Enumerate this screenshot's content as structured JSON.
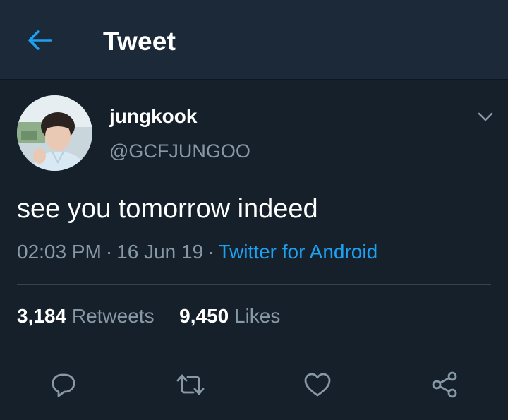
{
  "header": {
    "back_icon": "arrow-left-icon",
    "title": "Tweet"
  },
  "tweet": {
    "display_name": "jungkook",
    "handle": "@GCFJUNGOO",
    "text": "see you tomorrow indeed",
    "time": "02:03 PM",
    "date": "16 Jun 19",
    "separator": "·",
    "source": "Twitter for Android",
    "stats": {
      "retweets_count": "3,184",
      "retweets_label": "Retweets",
      "likes_count": "9,450",
      "likes_label": "Likes"
    }
  },
  "actions": [
    "reply-icon",
    "retweet-icon",
    "like-icon",
    "share-icon"
  ],
  "colors": {
    "background": "#15202b",
    "header": "#1c2938",
    "accent": "#1da1f2",
    "secondary_text": "#8899a6",
    "divider": "#38444d"
  }
}
